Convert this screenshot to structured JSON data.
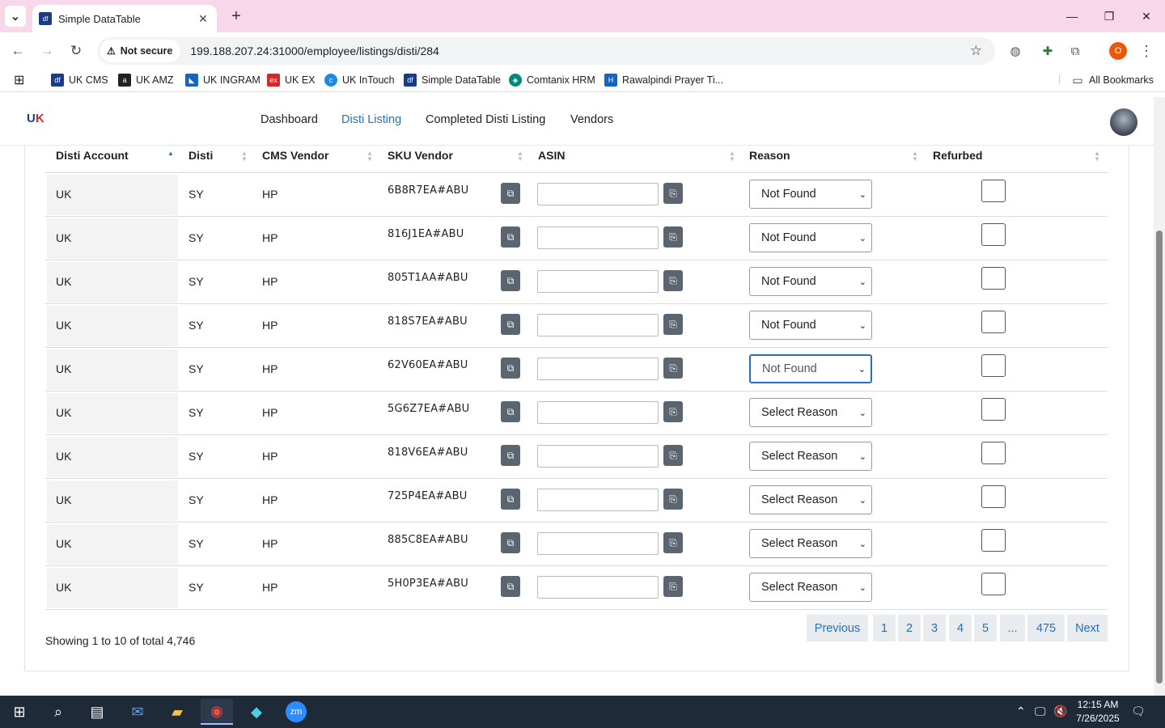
{
  "browser": {
    "tab_title": "Simple DataTable",
    "security_label": "Not secure",
    "url": "199.188.207.24:31000/employee/listings/disti/284",
    "profile_initial": "O"
  },
  "bookmarks": [
    {
      "label": "UK CMS",
      "color": "#1a3a8a"
    },
    {
      "label": "UK AMZ",
      "color": "#222222"
    },
    {
      "label": "UK INGRAM",
      "color": "#1565c0"
    },
    {
      "label": "UK EX",
      "color": "#d62828"
    },
    {
      "label": "UK InTouch",
      "color": "#1e88e5"
    },
    {
      "label": "Simple DataTable",
      "color": "#1a3a8a"
    },
    {
      "label": "Comtanix HRM",
      "color": "#00897b"
    },
    {
      "label": "Rawalpindi Prayer Ti...",
      "color": "#1565c0"
    }
  ],
  "all_bookmarks_label": "All Bookmarks",
  "nav": {
    "items": [
      "Dashboard",
      "Disti Listing",
      "Completed Disti Listing",
      "Vendors"
    ],
    "active": "Disti Listing"
  },
  "table": {
    "headers": [
      "Disti Account",
      "Disti",
      "CMS Vendor",
      "SKU Vendor",
      "ASIN",
      "Reason",
      "Refurbed"
    ],
    "rows": [
      {
        "account": "UK",
        "disti": "SY",
        "vendor": "HP",
        "sku": "6B8R7EA#ABU",
        "asin": "",
        "reason": "Not Found",
        "refurbed": false
      },
      {
        "account": "UK",
        "disti": "SY",
        "vendor": "HP",
        "sku": "816J1EA#ABU",
        "asin": "",
        "reason": "Not Found",
        "refurbed": false
      },
      {
        "account": "UK",
        "disti": "SY",
        "vendor": "HP",
        "sku": "805T1AA#ABU",
        "asin": "",
        "reason": "Not Found",
        "refurbed": false
      },
      {
        "account": "UK",
        "disti": "SY",
        "vendor": "HP",
        "sku": "818S7EA#ABU",
        "asin": "",
        "reason": "Not Found",
        "refurbed": false
      },
      {
        "account": "UK",
        "disti": "SY",
        "vendor": "HP",
        "sku": "62V60EA#ABU",
        "asin": "",
        "reason": "Not Found",
        "refurbed": false,
        "focused": true
      },
      {
        "account": "UK",
        "disti": "SY",
        "vendor": "HP",
        "sku": "5G6Z7EA#ABU",
        "asin": "",
        "reason": "Select Reason",
        "refurbed": false
      },
      {
        "account": "UK",
        "disti": "SY",
        "vendor": "HP",
        "sku": "818V6EA#ABU",
        "asin": "",
        "reason": "Select Reason",
        "refurbed": false
      },
      {
        "account": "UK",
        "disti": "SY",
        "vendor": "HP",
        "sku": "725P4EA#ABU",
        "asin": "",
        "reason": "Select Reason",
        "refurbed": false
      },
      {
        "account": "UK",
        "disti": "SY",
        "vendor": "HP",
        "sku": "885C8EA#ABU",
        "asin": "",
        "reason": "Select Reason",
        "refurbed": false
      },
      {
        "account": "UK",
        "disti": "SY",
        "vendor": "HP",
        "sku": "5H0P3EA#ABU",
        "asin": "",
        "reason": "Select Reason",
        "refurbed": false
      }
    ]
  },
  "footer": {
    "showing": "Showing 1 to 10 of total 4,746",
    "pagination": [
      "Previous",
      "1",
      "2",
      "3",
      "4",
      "5",
      "...",
      "475",
      "Next"
    ]
  },
  "taskbar": {
    "time": "12:15 AM",
    "date": "7/26/2025"
  }
}
